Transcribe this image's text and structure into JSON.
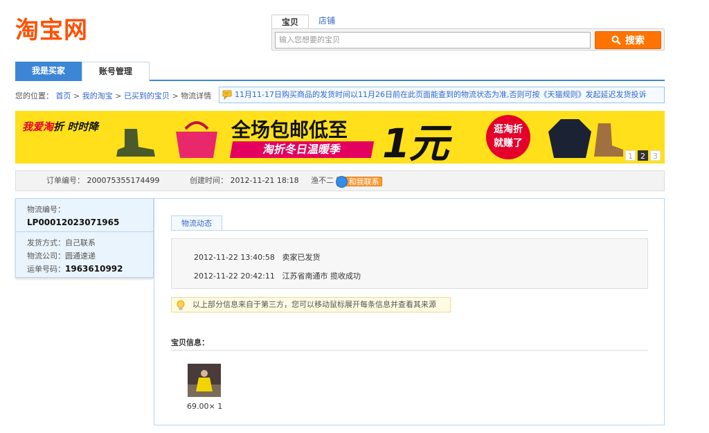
{
  "logo": {
    "text": "淘宝网"
  },
  "search": {
    "tabs": [
      "宝贝",
      "店铺"
    ],
    "placeholder": "输入您想要的宝贝",
    "button_label": "搜索"
  },
  "nav": {
    "tabs": [
      "我是买家",
      "账号管理"
    ]
  },
  "breadcrumb": {
    "prefix": "您的位置：",
    "links": [
      "首页",
      "我的淘宝",
      "已买到的宝贝"
    ],
    "sep": ">",
    "current": "物流详情"
  },
  "notice": {
    "text": "11月11-17日购买商品的发货时间以11月26日前在此页面能查到的物流状态为准,否则可按《天猫规则》发起延迟发货投诉"
  },
  "banner": {
    "left_brand": "我爱淘",
    "left_brand_suffix": "折",
    "left_slogan": "时时降",
    "headline": "全场包邮低至",
    "price": "1元",
    "sub": "淘折冬日温暖季",
    "circle_line1": "逛淘折",
    "circle_line2": "就赚了",
    "pager": [
      "1",
      "2",
      "3"
    ]
  },
  "order": {
    "no_label": "订单编号：",
    "no_value": "200075355174499",
    "created_label": "创建时间：",
    "created_value": "2012-11-21 18:18",
    "seller": "渔不二",
    "chat_label": "和我联系"
  },
  "logistics": {
    "no_label": "物流编号：",
    "no_value": "LP00012023071965",
    "method_label": "发货方式：",
    "method_value": "自己联系",
    "company_label": "物流公司：",
    "company_value": "圆通速递",
    "waybill_label": "运单号码：",
    "waybill_value": "1963610992"
  },
  "tracking": {
    "tab_label": "物流动态",
    "events": [
      {
        "time": "2012-11-22 13:40:58",
        "desc": "卖家已发货"
      },
      {
        "time": "2012-11-22 20:42:11",
        "desc": "江苏省南通市 揽收成功"
      }
    ],
    "tip": "以上部分信息来自于第三方，您可以移动鼠标展开每条信息并查看其来源"
  },
  "item": {
    "title": "宝贝信息：",
    "price_qty": "69.00× 1"
  },
  "colors": {
    "brand": "#ff5000",
    "search_button": "#ff7300",
    "nav_blue": "#3d86d5",
    "banner_yellow": "#ffe01a"
  }
}
